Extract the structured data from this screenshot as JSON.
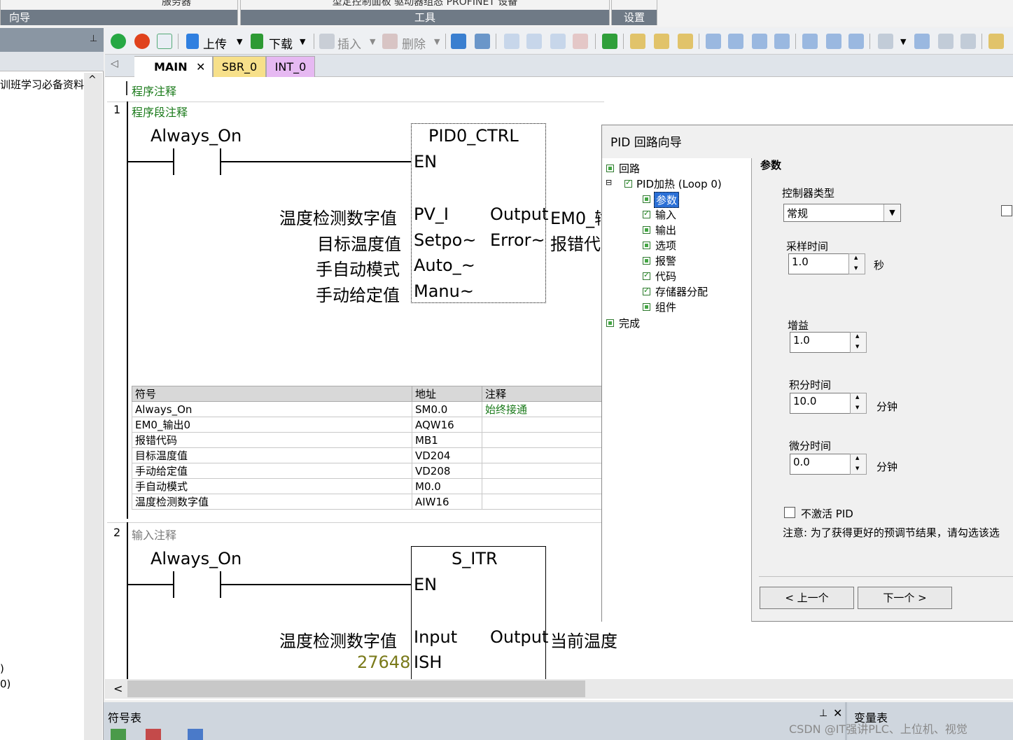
{
  "ribbon": {
    "group_nav": "向导",
    "group_tools": "工具",
    "group_settings": "设置",
    "top_partial_left": "服务器",
    "top_partial_mid": "型定控制面板  驱动器组态  PROFINET 设备"
  },
  "nav": {
    "tree_item": "训班学习必备资料",
    "bottom_text_1": ")",
    "bottom_text_2": "0)"
  },
  "toolbar": {
    "upload": "上传",
    "download": "下载",
    "insert": "插入",
    "delete": "删除"
  },
  "tabs": [
    {
      "label": "MAIN",
      "color": "#ffffff"
    },
    {
      "label": "SBR_0",
      "color": "#f7e08a"
    },
    {
      "label": "INT_0",
      "color": "#e6b9f2"
    }
  ],
  "program": {
    "program_comment": "程序注释",
    "network1": {
      "number": "1",
      "comment": "程序段注释",
      "contact": "Always_On",
      "block_name": "PID0_CTRL",
      "pin_en": "EN",
      "inputs": [
        {
          "var": "温度检测数字值",
          "pin": "PV_I"
        },
        {
          "var": "目标温度值",
          "pin": "Setpo~"
        },
        {
          "var": "手自动模式",
          "pin": "Auto_~"
        },
        {
          "var": "手动给定值",
          "pin": "Manu~"
        }
      ],
      "outputs": [
        {
          "pin": "Output",
          "var": "EM0_输"
        },
        {
          "pin": "Error~",
          "var": "报错代"
        }
      ],
      "symbol_table": {
        "headers": [
          "符号",
          "地址",
          "注释"
        ],
        "rows": [
          [
            "Always_On",
            "SM0.0",
            "始终接通"
          ],
          [
            "EM0_输出0",
            "AQW16",
            ""
          ],
          [
            "报错代码",
            "MB1",
            ""
          ],
          [
            "目标温度值",
            "VD204",
            ""
          ],
          [
            "手动给定值",
            "VD208",
            ""
          ],
          [
            "手自动模式",
            "M0.0",
            ""
          ],
          [
            "温度检测数字值",
            "AIW16",
            ""
          ]
        ]
      }
    },
    "network2": {
      "number": "2",
      "comment": "输入注释",
      "contact": "Always_On",
      "block_name": "S_ITR",
      "pin_en": "EN",
      "input_var": "温度检测数字值",
      "input_pin": "Input",
      "output_pin": "Output",
      "output_var": "当前温度",
      "ish_value": "27648",
      "ish_pin": "ISH"
    }
  },
  "bottom": {
    "symbol_pane": "符号表",
    "var_pane": "变量表",
    "watermark": "CSDN @IT强讲PLC、上位机、视觉"
  },
  "dialog": {
    "title": "PID 回路向导",
    "tree": {
      "root": "回路",
      "loop": "PID加热 (Loop 0)",
      "items": [
        "参数",
        "输入",
        "输出",
        "选项",
        "报警",
        "代码",
        "存储器分配",
        "组件"
      ],
      "done": "完成"
    },
    "section_title": "参数",
    "controller_type_label": "控制器类型",
    "controller_type_value": "常规",
    "sample_time_label": "采样时间",
    "sample_time_value": "1.0",
    "sample_time_unit": "秒",
    "gain_label": "增益",
    "gain_value": "1.0",
    "integral_label": "积分时间",
    "integral_value": "10.0",
    "integral_unit": "分钟",
    "derivative_label": "微分时间",
    "derivative_value": "0.0",
    "derivative_unit": "分钟",
    "deactivate_label": "不激活 PID",
    "note": "注意: 为了获得更好的预调节结果，请勾选该选",
    "prev_button": "< 上一个",
    "next_button": "下一个 >"
  }
}
